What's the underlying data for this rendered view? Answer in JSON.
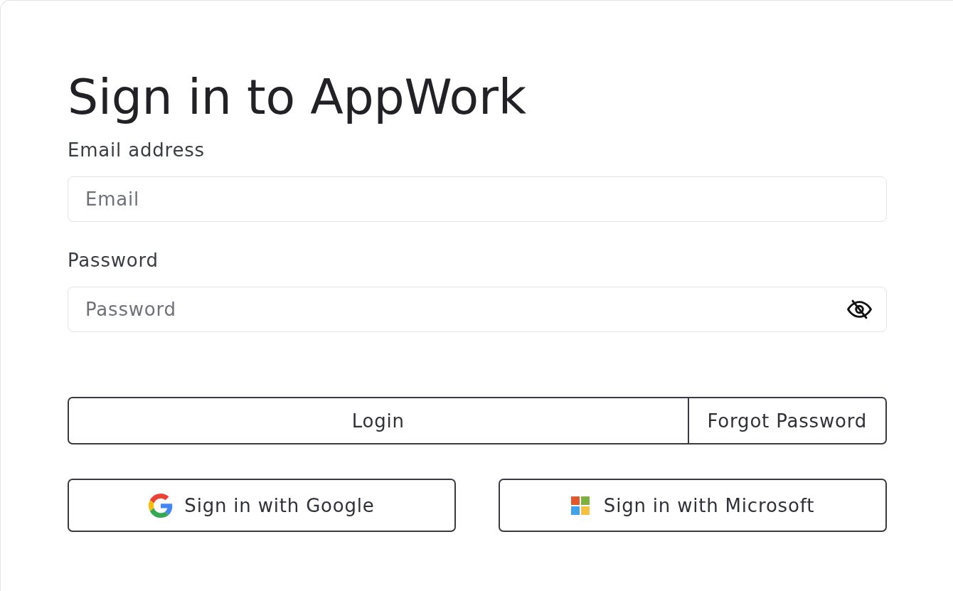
{
  "title": "Sign in to AppWork",
  "fields": [
    {
      "label": "Email address",
      "placeholder": "Email",
      "kind": "email"
    },
    {
      "label": "Password",
      "placeholder": "Password",
      "kind": "password"
    }
  ],
  "buttons": [
    {
      "label": "Login",
      "kind": "submit"
    },
    {
      "label": "Forgot Password",
      "kind": "link"
    }
  ],
  "social": [
    {
      "label": "Sign in with Google",
      "kind": "google"
    },
    {
      "label": "Sign in with Microsoft",
      "kind": "microsoft"
    }
  ]
}
